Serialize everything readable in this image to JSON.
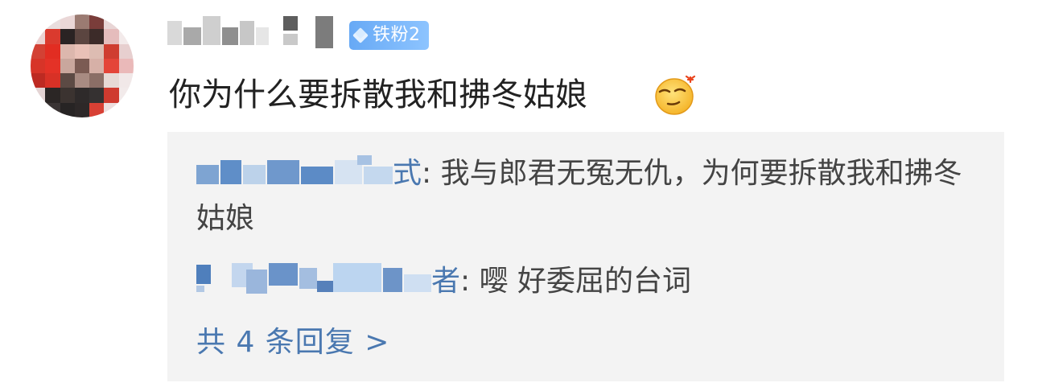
{
  "comment": {
    "username": "",
    "fan_badge": "铁粉2",
    "text": "你为什么要拆散我和拂冬姑娘",
    "emoji_icon": "smirk-emoji"
  },
  "replies": [
    {
      "name_tail": "式",
      "separator": ": ",
      "text": "我与郎君无冤无仇，为何要拆散我和拂冬姑娘"
    },
    {
      "name_tail": "者",
      "separator": ": ",
      "text": "嘤 好委屈的台词"
    }
  ],
  "more_replies": "共 4 条回复 >",
  "colors": {
    "link_blue": "#4a78b0",
    "badge_blue": "#7ab6f8",
    "reply_bg": "#f3f3f3",
    "text": "#222222"
  }
}
